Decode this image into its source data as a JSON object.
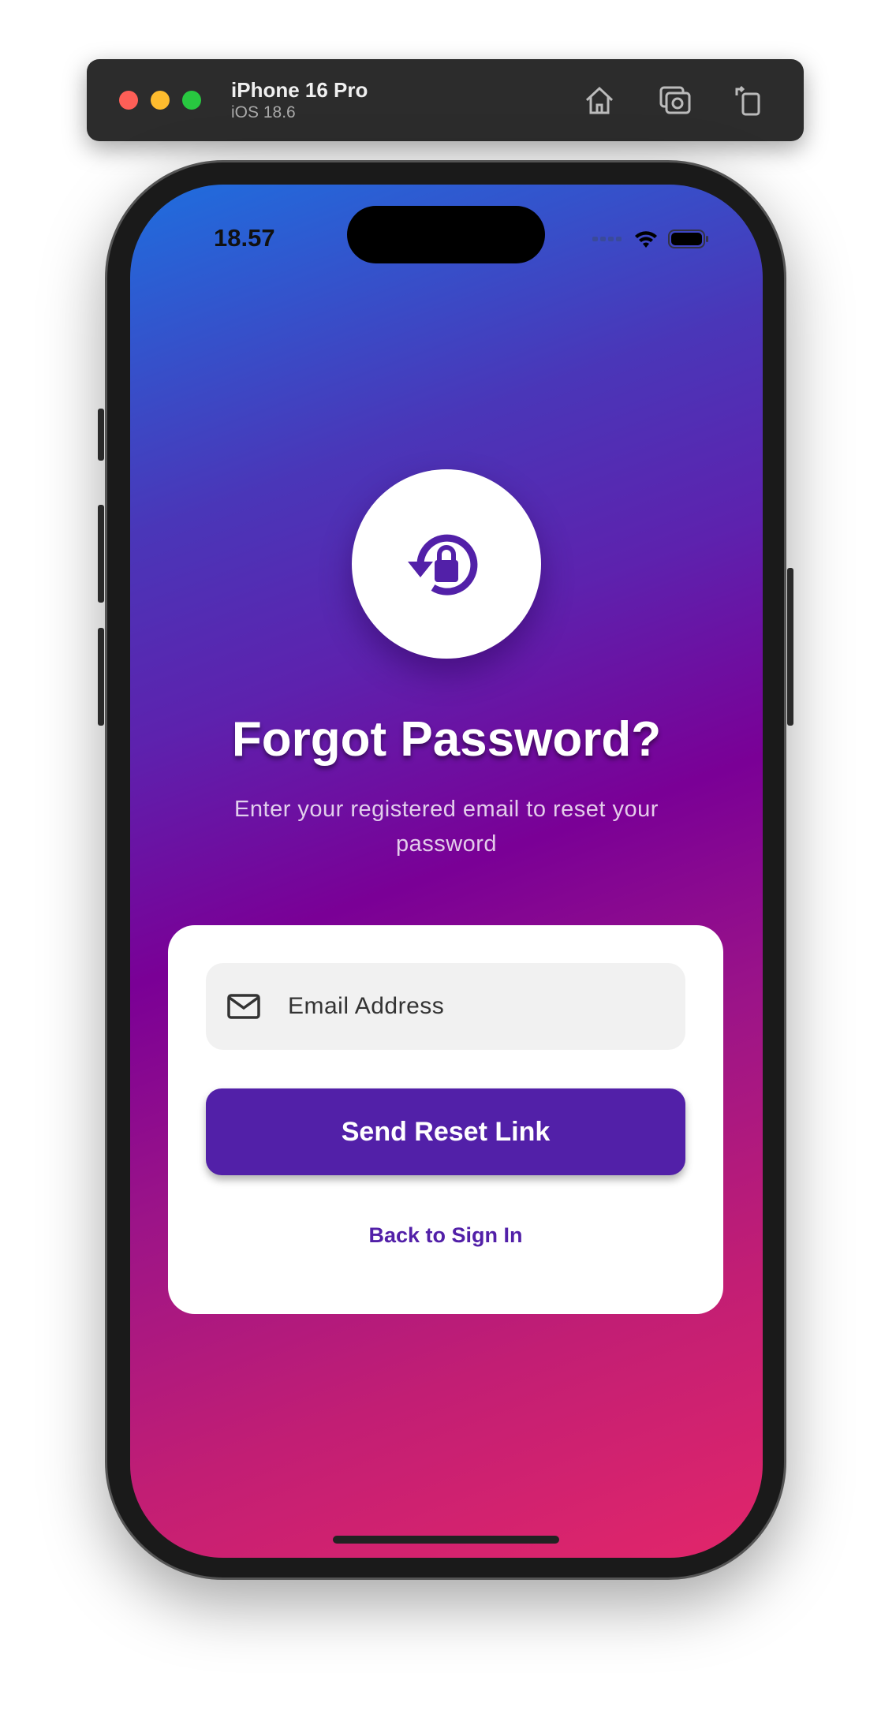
{
  "simulator": {
    "device_name": "iPhone 16 Pro",
    "os_version": "iOS 18.6",
    "icons": [
      "home-icon",
      "screenshot-icon",
      "rotate-icon"
    ]
  },
  "status_bar": {
    "time": "18.57"
  },
  "screen": {
    "title": "Forgot Password?",
    "subtitle": "Enter your registered email to reset your password",
    "email_placeholder": "Email Address",
    "submit_label": "Send Reset Link",
    "back_link": "Back to Sign In"
  },
  "colors": {
    "accent": "#5220a8",
    "gradient_start": "#1f6ede",
    "gradient_mid": "#7a0096",
    "gradient_end": "#e2266a"
  }
}
